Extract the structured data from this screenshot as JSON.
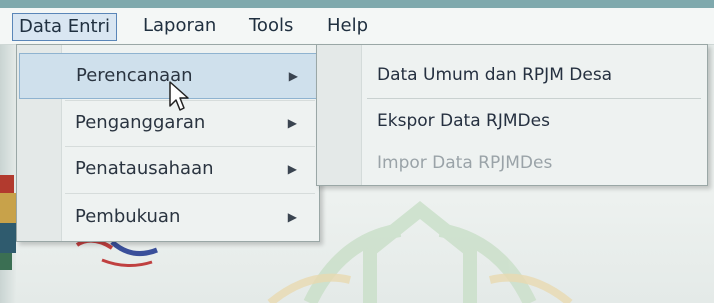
{
  "menubar": {
    "items": [
      {
        "label": "Data Entri",
        "active": true
      },
      {
        "label": "Laporan"
      },
      {
        "label": "Tools"
      },
      {
        "label": "Help"
      }
    ]
  },
  "dropdown": {
    "items": [
      {
        "label": "Perencanaan",
        "selected": true,
        "has_submenu": true
      },
      {
        "label": "Penganggaran",
        "has_submenu": true
      },
      {
        "label": "Penatausahaan",
        "has_submenu": true
      },
      {
        "label": "Pembukuan",
        "has_submenu": true
      }
    ],
    "arrow_glyph": "▶"
  },
  "submenu": {
    "items": [
      {
        "label": "Data Umum dan RPJM Desa",
        "enabled": true
      },
      {
        "label": "Ekspor Data RJMDes",
        "enabled": true
      },
      {
        "label": "Impor Data RPJMDes",
        "enabled": false
      }
    ]
  },
  "colors": {
    "accent_border": "#5a86b8",
    "highlight": "#cfe0ec",
    "disabled_text": "#9aa3a8"
  }
}
